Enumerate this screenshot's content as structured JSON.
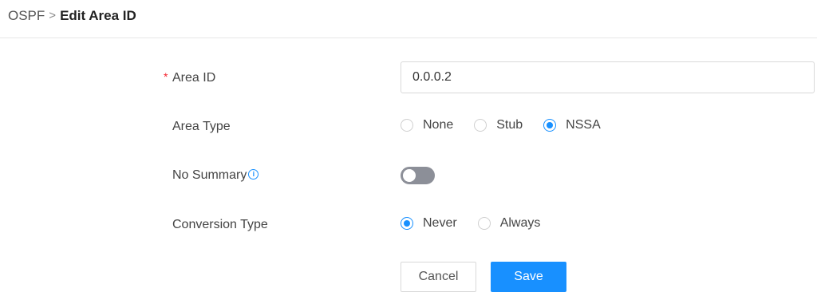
{
  "breadcrumb": {
    "parent": "OSPF",
    "separator": ">",
    "current": "Edit Area ID"
  },
  "form": {
    "area_id": {
      "required_mark": "*",
      "label": "Area ID",
      "value": "0.0.0.2"
    },
    "area_type": {
      "label": "Area Type",
      "options": [
        "None",
        "Stub",
        "NSSA"
      ],
      "selected": "NSSA"
    },
    "no_summary": {
      "label": "No Summary",
      "info_icon": "i",
      "enabled": false
    },
    "conversion_type": {
      "label": "Conversion Type",
      "options": [
        "Never",
        "Always"
      ],
      "selected": "Never"
    }
  },
  "actions": {
    "cancel_label": "Cancel",
    "save_label": "Save"
  },
  "colors": {
    "accent": "#1890ff",
    "required": "#f5222d",
    "toggle_off": "#8c8f98"
  }
}
